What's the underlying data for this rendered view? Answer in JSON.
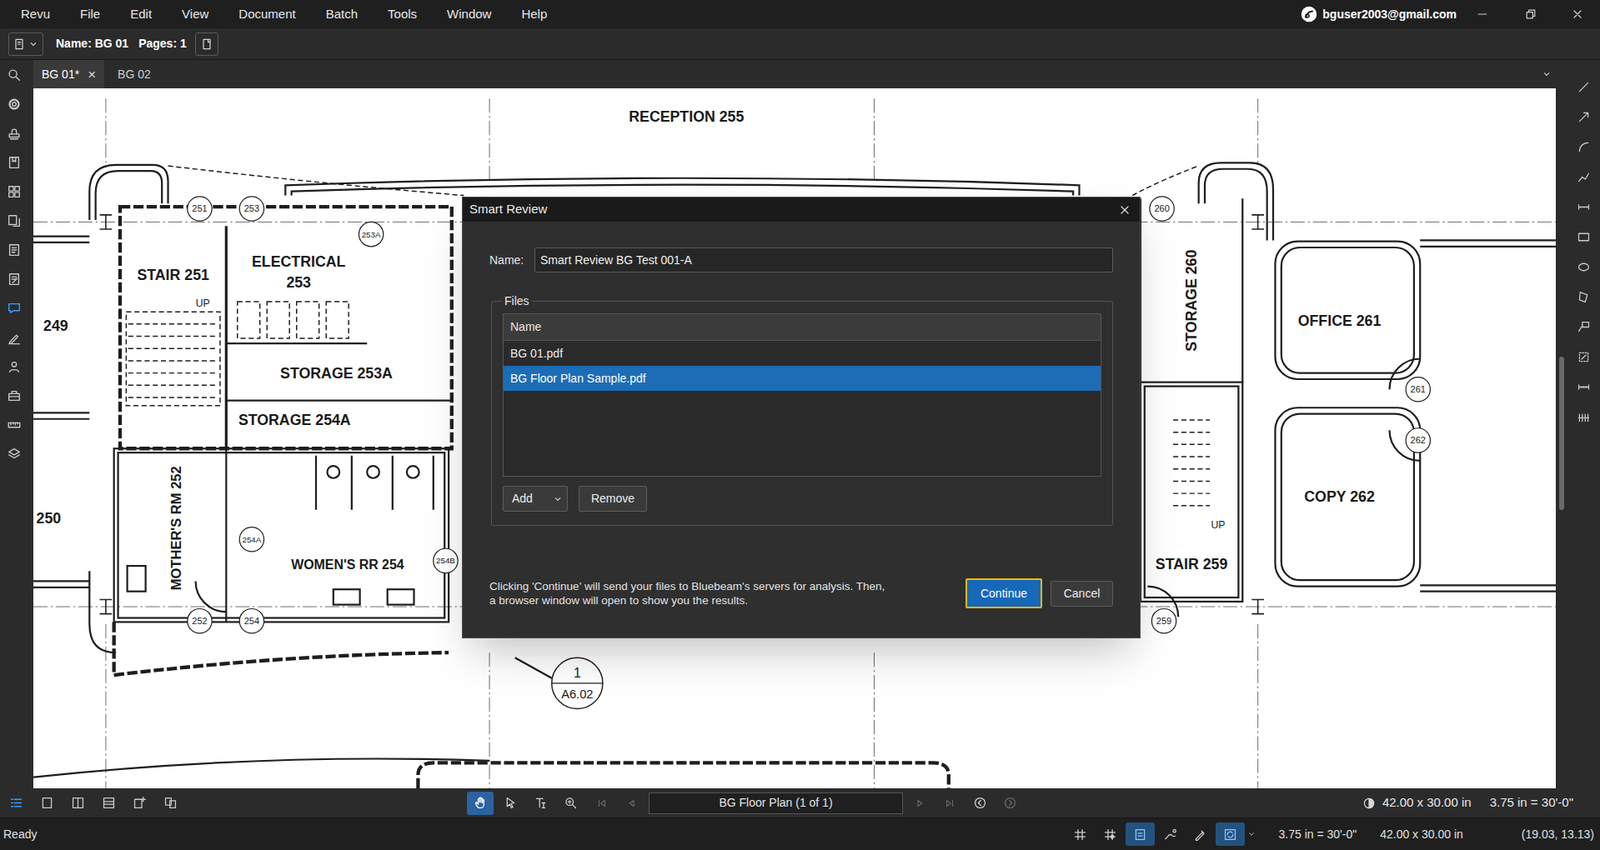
{
  "menu": [
    "Revu",
    "File",
    "Edit",
    "View",
    "Document",
    "Batch",
    "Tools",
    "Window",
    "Help"
  ],
  "account": {
    "email": "bguser2003@gmail.com"
  },
  "document_bar": {
    "name": "Name: BG 01",
    "pages": "Pages: 1"
  },
  "tabs": [
    {
      "label": "BG 01*",
      "selected": true,
      "close": "×"
    },
    {
      "label": "BG 02",
      "selected": false
    }
  ],
  "left_toolbar": [
    {
      "selected": false
    },
    {
      "selected": false
    },
    {
      "selected": false
    },
    {
      "selected": false
    },
    {
      "selected": false
    },
    {
      "selected": false
    },
    {
      "selected": false
    },
    {
      "selected": false
    },
    {
      "selected": true
    },
    {
      "selected": false
    },
    {
      "selected": false
    },
    {
      "selected": false
    },
    {
      "selected": false
    },
    {
      "selected": false
    }
  ],
  "drawing": {
    "rooms": [
      {
        "lines": [
          "RECEPTION 255"
        ],
        "kind": "horizontal"
      },
      {
        "lines": [
          "STAIR 251"
        ],
        "kind": "horizontal"
      },
      {
        "lines": [
          "ELECTRICAL",
          "253"
        ],
        "kind": "horizontal"
      },
      {
        "lines": [
          "STORAGE 253A"
        ],
        "kind": "horizontal"
      },
      {
        "lines": [
          "STORAGE 254A"
        ],
        "kind": "horizontal"
      },
      {
        "lines": [
          "249"
        ],
        "kind": "horizontal"
      },
      {
        "lines": [
          "250"
        ],
        "kind": "horizontal"
      },
      {
        "lines": [
          "MOTHER'S RM 252"
        ],
        "kind": "vertical"
      },
      {
        "lines": [
          "WOMEN'S RR 254"
        ],
        "kind": "horizontal"
      },
      {
        "lines": [
          "STORAGE 260"
        ],
        "kind": "vertical"
      },
      {
        "lines": [
          "OFFICE 261"
        ],
        "kind": "horizontal"
      },
      {
        "lines": [
          "COPY 262"
        ],
        "kind": "horizontal"
      },
      {
        "lines": [
          "STAIR 259"
        ],
        "kind": "horizontal"
      }
    ],
    "tags": [
      "251",
      "253",
      "253A",
      "260",
      "261",
      "262",
      "254A",
      "254B",
      "252",
      "254",
      "259"
    ],
    "stair_labels": [
      "UP",
      "UP"
    ],
    "section": {
      "number": "1",
      "sheet": "A6.02"
    }
  },
  "dialog": {
    "title": "Smart Review",
    "name_label": "Name:",
    "name_value": "Smart Review BG Test 001-A",
    "files_legend": "Files",
    "column": "Name",
    "files": [
      {
        "name": "BG 01.pdf",
        "selected": false
      },
      {
        "name": "BG Floor Plan Sample.pdf",
        "selected": true
      }
    ],
    "add_button": "Add",
    "remove_button": "Remove",
    "notice": [
      "Clicking 'Continue' will send your files to Bluebeam's servers for analysis. Then,",
      "a browser window will open to show you the results."
    ],
    "continue_button": "Continue",
    "cancel_button": "Cancel"
  },
  "view_tools": [
    {
      "selected": true
    },
    {
      "selected": false
    },
    {
      "selected": false
    },
    {
      "selected": false
    },
    {
      "selected": false
    },
    {
      "selected": false
    }
  ],
  "nav_tools": [
    {
      "selected": true
    },
    {
      "selected": false
    },
    {
      "selected": false
    },
    {
      "selected": false
    }
  ],
  "page_buttons": [
    {
      "enabled": false
    },
    {
      "enabled": false
    },
    {
      "enabled": false
    },
    {
      "enabled": false
    }
  ],
  "history_buttons": [
    {
      "enabled": true
    },
    {
      "enabled": false
    }
  ],
  "page_field": "BG Floor Plan (1 of 1)",
  "page_size": "42.00 x 30.00 in",
  "scale": "3.75 in = 30'-0\"",
  "status_bar": {
    "text": "Ready",
    "toggles": [
      {
        "selected": false
      },
      {
        "selected": false
      },
      {
        "selected": true
      },
      {
        "selected": false
      },
      {
        "selected": false
      },
      {
        "selected": true
      }
    ],
    "scale": "3.75 in = 30'-0\"",
    "size": "42.00 x 30.00 in",
    "cursor": "(19.03, 13.13)"
  }
}
